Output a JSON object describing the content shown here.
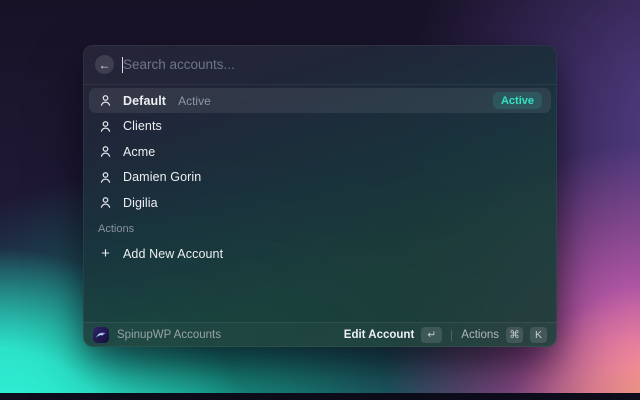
{
  "colors": {
    "accent_teal": "#35E2C6",
    "badge_bg_tint": "#2FE0C4",
    "bg_navy": "#1D1733",
    "bg_purple": "#57408C",
    "bg_pink": "#EF6CC9",
    "bg_orange": "#F4AA64",
    "bg_turquoise": "#2FFADB",
    "bg_teal": "#14AD92"
  },
  "search": {
    "placeholder": "Search accounts...",
    "back_icon_glyph": "←"
  },
  "list": {
    "accounts": [
      {
        "label": "Default",
        "subtitle": "Active",
        "badge": "Active"
      },
      {
        "label": "Clients"
      },
      {
        "label": "Acme"
      },
      {
        "label": "Damien Gorin"
      },
      {
        "label": "Digilia"
      }
    ],
    "actions_section": {
      "header": "Actions",
      "items": [
        {
          "label": "Add New Account",
          "icon_glyph": "+"
        }
      ]
    }
  },
  "footer": {
    "app_name": "SpinupWP Accounts",
    "primary_action": {
      "label": "Edit Account",
      "key": "↵"
    },
    "secondary_action": {
      "label": "Actions",
      "keys": [
        "⌘",
        "K"
      ]
    }
  }
}
